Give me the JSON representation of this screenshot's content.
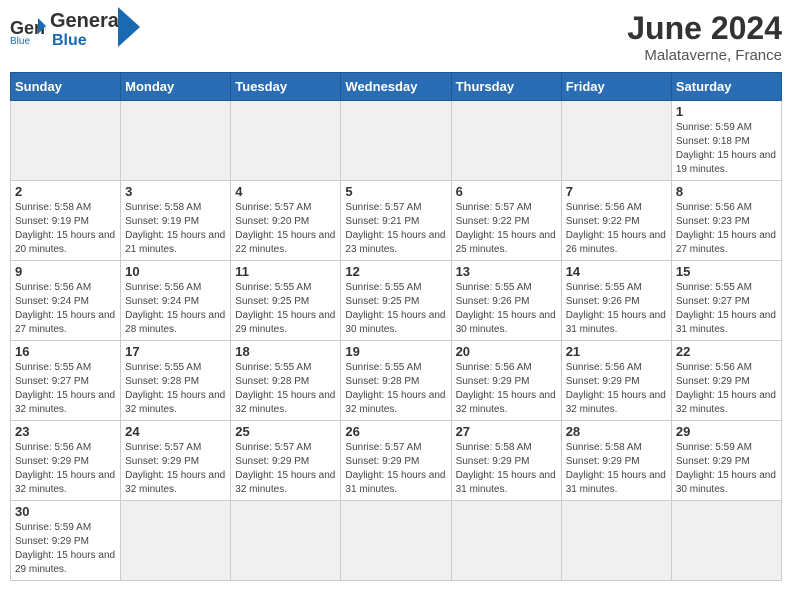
{
  "header": {
    "logo_general": "General",
    "logo_blue": "Blue",
    "month_title": "June 2024",
    "location": "Malataverne, France"
  },
  "weekdays": [
    "Sunday",
    "Monday",
    "Tuesday",
    "Wednesday",
    "Thursday",
    "Friday",
    "Saturday"
  ],
  "weeks": [
    [
      {
        "day": "",
        "empty": true
      },
      {
        "day": "",
        "empty": true
      },
      {
        "day": "",
        "empty": true
      },
      {
        "day": "",
        "empty": true
      },
      {
        "day": "",
        "empty": true
      },
      {
        "day": "",
        "empty": true
      },
      {
        "day": "1",
        "sunrise": "5:59 AM",
        "sunset": "9:18 PM",
        "daylight": "15 hours and 19 minutes."
      }
    ],
    [
      {
        "day": "2",
        "sunrise": "5:58 AM",
        "sunset": "9:19 PM",
        "daylight": "15 hours and 20 minutes."
      },
      {
        "day": "3",
        "sunrise": "5:58 AM",
        "sunset": "9:19 PM",
        "daylight": "15 hours and 21 minutes."
      },
      {
        "day": "4",
        "sunrise": "5:57 AM",
        "sunset": "9:20 PM",
        "daylight": "15 hours and 22 minutes."
      },
      {
        "day": "5",
        "sunrise": "5:57 AM",
        "sunset": "9:21 PM",
        "daylight": "15 hours and 23 minutes."
      },
      {
        "day": "6",
        "sunrise": "5:57 AM",
        "sunset": "9:22 PM",
        "daylight": "15 hours and 25 minutes."
      },
      {
        "day": "7",
        "sunrise": "5:56 AM",
        "sunset": "9:22 PM",
        "daylight": "15 hours and 26 minutes."
      },
      {
        "day": "8",
        "sunrise": "5:56 AM",
        "sunset": "9:23 PM",
        "daylight": "15 hours and 27 minutes."
      }
    ],
    [
      {
        "day": "9",
        "sunrise": "5:56 AM",
        "sunset": "9:24 PM",
        "daylight": "15 hours and 27 minutes."
      },
      {
        "day": "10",
        "sunrise": "5:56 AM",
        "sunset": "9:24 PM",
        "daylight": "15 hours and 28 minutes."
      },
      {
        "day": "11",
        "sunrise": "5:55 AM",
        "sunset": "9:25 PM",
        "daylight": "15 hours and 29 minutes."
      },
      {
        "day": "12",
        "sunrise": "5:55 AM",
        "sunset": "9:25 PM",
        "daylight": "15 hours and 30 minutes."
      },
      {
        "day": "13",
        "sunrise": "5:55 AM",
        "sunset": "9:26 PM",
        "daylight": "15 hours and 30 minutes."
      },
      {
        "day": "14",
        "sunrise": "5:55 AM",
        "sunset": "9:26 PM",
        "daylight": "15 hours and 31 minutes."
      },
      {
        "day": "15",
        "sunrise": "5:55 AM",
        "sunset": "9:27 PM",
        "daylight": "15 hours and 31 minutes."
      }
    ],
    [
      {
        "day": "16",
        "sunrise": "5:55 AM",
        "sunset": "9:27 PM",
        "daylight": "15 hours and 32 minutes."
      },
      {
        "day": "17",
        "sunrise": "5:55 AM",
        "sunset": "9:28 PM",
        "daylight": "15 hours and 32 minutes."
      },
      {
        "day": "18",
        "sunrise": "5:55 AM",
        "sunset": "9:28 PM",
        "daylight": "15 hours and 32 minutes."
      },
      {
        "day": "19",
        "sunrise": "5:55 AM",
        "sunset": "9:28 PM",
        "daylight": "15 hours and 32 minutes."
      },
      {
        "day": "20",
        "sunrise": "5:56 AM",
        "sunset": "9:29 PM",
        "daylight": "15 hours and 32 minutes."
      },
      {
        "day": "21",
        "sunrise": "5:56 AM",
        "sunset": "9:29 PM",
        "daylight": "15 hours and 32 minutes."
      },
      {
        "day": "22",
        "sunrise": "5:56 AM",
        "sunset": "9:29 PM",
        "daylight": "15 hours and 32 minutes."
      }
    ],
    [
      {
        "day": "23",
        "sunrise": "5:56 AM",
        "sunset": "9:29 PM",
        "daylight": "15 hours and 32 minutes."
      },
      {
        "day": "24",
        "sunrise": "5:57 AM",
        "sunset": "9:29 PM",
        "daylight": "15 hours and 32 minutes."
      },
      {
        "day": "25",
        "sunrise": "5:57 AM",
        "sunset": "9:29 PM",
        "daylight": "15 hours and 32 minutes."
      },
      {
        "day": "26",
        "sunrise": "5:57 AM",
        "sunset": "9:29 PM",
        "daylight": "15 hours and 31 minutes."
      },
      {
        "day": "27",
        "sunrise": "5:58 AM",
        "sunset": "9:29 PM",
        "daylight": "15 hours and 31 minutes."
      },
      {
        "day": "28",
        "sunrise": "5:58 AM",
        "sunset": "9:29 PM",
        "daylight": "15 hours and 31 minutes."
      },
      {
        "day": "29",
        "sunrise": "5:59 AM",
        "sunset": "9:29 PM",
        "daylight": "15 hours and 30 minutes."
      }
    ],
    [
      {
        "day": "30",
        "sunrise": "5:59 AM",
        "sunset": "9:29 PM",
        "daylight": "15 hours and 29 minutes."
      },
      {
        "day": "",
        "empty": true
      },
      {
        "day": "",
        "empty": true
      },
      {
        "day": "",
        "empty": true
      },
      {
        "day": "",
        "empty": true
      },
      {
        "day": "",
        "empty": true
      },
      {
        "day": "",
        "empty": true
      }
    ]
  ]
}
